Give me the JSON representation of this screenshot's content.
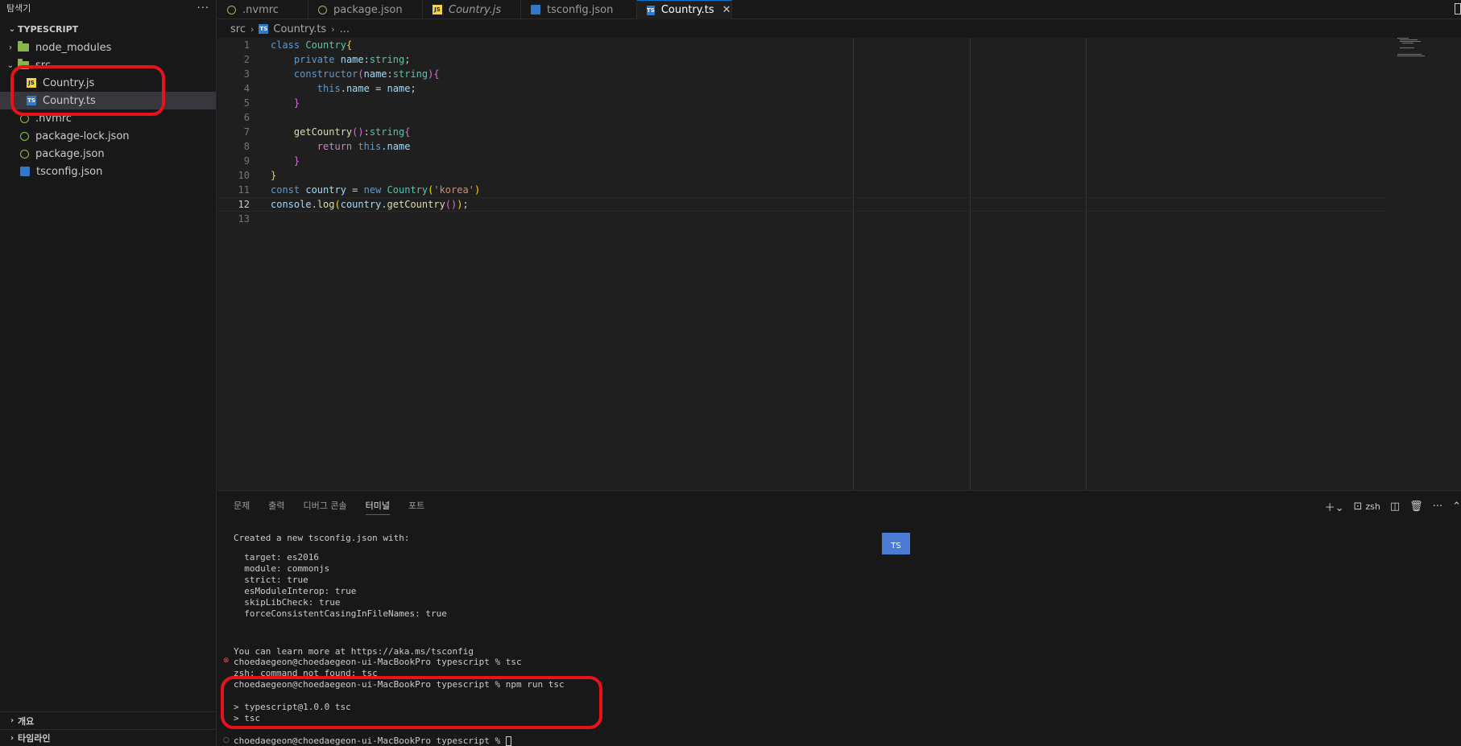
{
  "sidebar": {
    "title": "탐색기",
    "more": "···",
    "project": "TYPESCRIPT",
    "items": [
      {
        "label": "node_modules",
        "icon": "folder-icon"
      },
      {
        "label": "src",
        "icon": "chevron-down-icon"
      },
      {
        "label": "Country.js",
        "icon": "js-file-icon"
      },
      {
        "label": "Country.ts",
        "icon": "ts-file-icon"
      },
      {
        "label": ".nvmrc",
        "icon": "nvmrc-file-icon"
      },
      {
        "label": "package-lock.json",
        "icon": "json-file-icon"
      },
      {
        "label": "package.json",
        "icon": "json-file-icon"
      },
      {
        "label": "tsconfig.json",
        "icon": "tsconfig-file-icon"
      }
    ],
    "outline": "개요",
    "timeline": "타임라인"
  },
  "tabs": [
    {
      "label": ".nvmrc"
    },
    {
      "label": "package.json"
    },
    {
      "label": "Country.js"
    },
    {
      "label": "tsconfig.json"
    },
    {
      "label": "Country.ts",
      "close": "✕"
    }
  ],
  "breadcrumb": {
    "folder": "src",
    "file": "Country.ts",
    "more": "..."
  },
  "editor": {
    "lines": [
      {
        "n": "1"
      },
      {
        "n": "2"
      },
      {
        "n": "3"
      },
      {
        "n": "4"
      },
      {
        "n": "5"
      },
      {
        "n": "6"
      },
      {
        "n": "7"
      },
      {
        "n": "8"
      },
      {
        "n": "9"
      },
      {
        "n": "10"
      },
      {
        "n": "11"
      },
      {
        "n": "12"
      },
      {
        "n": "13"
      }
    ],
    "tokens": {
      "l1": [
        "class",
        " ",
        "Country",
        "{"
      ],
      "l2": [
        "    ",
        "private",
        " ",
        "name",
        ":",
        "string",
        ";"
      ],
      "l3": [
        "    ",
        "constructor",
        "(",
        "name",
        ":",
        "string",
        ")",
        "{"
      ],
      "l4": [
        "        ",
        "this",
        ".",
        "name",
        " = ",
        "name",
        ";"
      ],
      "l5": [
        "    ",
        "}"
      ],
      "l7": [
        "    ",
        "getCountry",
        "()",
        ":",
        "string",
        "{"
      ],
      "l8": [
        "        ",
        "return",
        " ",
        "this",
        ".",
        "name"
      ],
      "l9": [
        "    ",
        "}"
      ],
      "l10": [
        "}"
      ],
      "l11": [
        "const",
        " ",
        "country",
        " = ",
        "new",
        " ",
        "Country",
        "(",
        "'korea'",
        ")"
      ],
      "l12": [
        "console",
        ".",
        "log",
        "(",
        "country",
        ".",
        "getCountry",
        "()",
        ")",
        ";"
      ]
    }
  },
  "panel": {
    "tabs": [
      "문제",
      "출력",
      "디버그 콘솔",
      "터미널",
      "포트"
    ],
    "shell": "zsh",
    "ts_badge": "TS",
    "terminal": [
      "Created a new tsconfig.json with:",
      "  target: es2016",
      "  module: commonjs",
      "  strict: true",
      "  esModuleInterop: true",
      "  skipLibCheck: true",
      "  forceConsistentCasingInFileNames: true",
      "You can learn more at https://aka.ms/tsconfig",
      "choedaegeon@choedaegeon-ui-MacBookPro typescript % tsc",
      "zsh: command not found: tsc",
      "choedaegeon@choedaegeon-ui-MacBookPro typescript % npm run tsc",
      "> typescript@1.0.0 tsc",
      "> tsc",
      "choedaegeon@choedaegeon-ui-MacBookPro typescript % "
    ],
    "deco_error": "⊗",
    "deco_ok": "○"
  },
  "colors": {
    "accent": "#0078d4",
    "annotation": "#e8121b"
  }
}
